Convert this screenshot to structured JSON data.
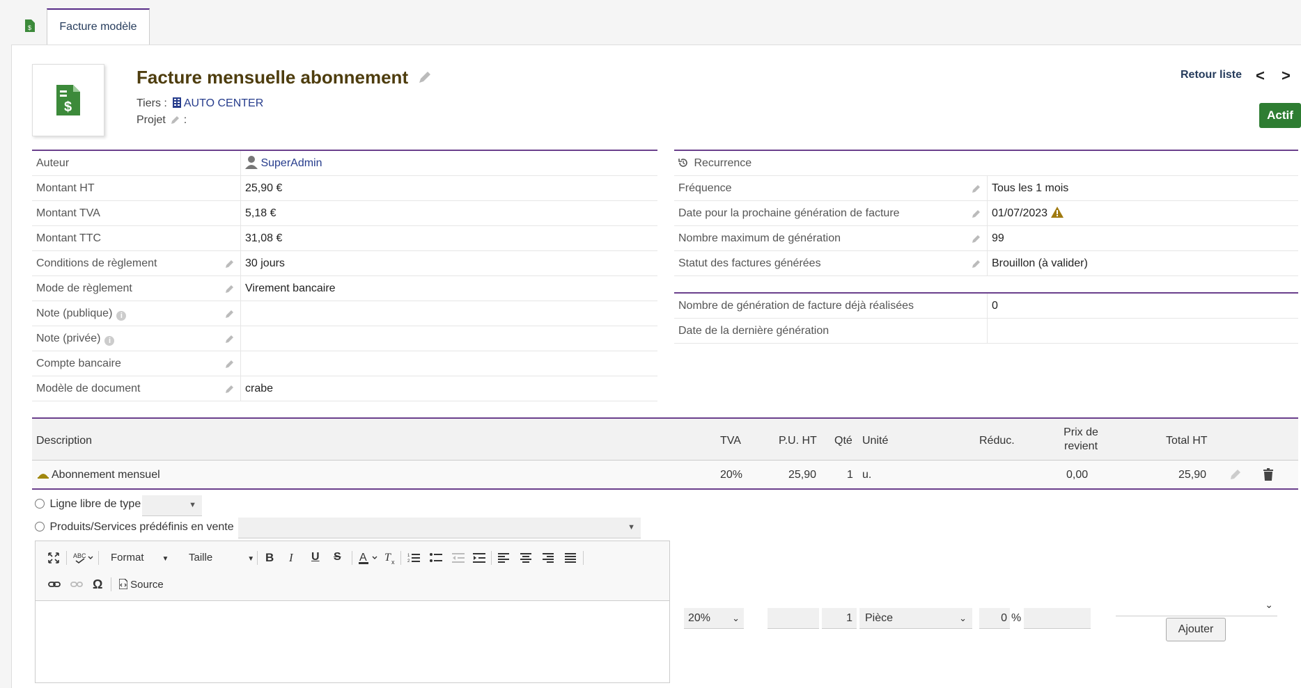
{
  "tabs": [
    {
      "label": "Facture modèle"
    }
  ],
  "header": {
    "ref": "Facture mensuelle abonnement",
    "tiers_label": "Tiers :",
    "tiers_name": "AUTO CENTER",
    "projet_label": "Projet",
    "projet_colon": ":",
    "back_label": "Retour liste",
    "prev_label": "<",
    "next_label": ">",
    "status": "Actif"
  },
  "left_fields": [
    {
      "label": "Auteur",
      "value": "SuperAdmin"
    },
    {
      "label": "Montant HT",
      "value": "25,90 €"
    },
    {
      "label": "Montant TVA",
      "value": "5,18 €"
    },
    {
      "label": "Montant TTC",
      "value": "31,08 €"
    },
    {
      "label": "Conditions de règlement",
      "value": "30 jours"
    },
    {
      "label": "Mode de règlement",
      "value": "Virement bancaire"
    },
    {
      "label": "Note (publique)",
      "value": ""
    },
    {
      "label": "Note (privée)",
      "value": ""
    },
    {
      "label": "Compte bancaire",
      "value": ""
    },
    {
      "label": "Modèle de document",
      "value": "crabe"
    }
  ],
  "recurrence": {
    "title": "Recurrence",
    "fields": [
      {
        "label": "Fréquence",
        "value": "Tous les 1 mois"
      },
      {
        "label": "Date pour la prochaine génération de facture",
        "value": "01/07/2023"
      },
      {
        "label": "Nombre maximum de génération",
        "value": "99"
      },
      {
        "label": "Statut des factures générées",
        "value": "Brouillon (à valider)"
      }
    ],
    "stats": [
      {
        "label": "Nombre de génération de facture déjà réalisées",
        "value": "0"
      },
      {
        "label": "Date de la dernière génération",
        "value": ""
      }
    ]
  },
  "lines_table": {
    "headers": {
      "description": "Description",
      "tva": "TVA",
      "pu_ht": "P.U. HT",
      "qty": "Qté",
      "unit": "Unité",
      "reduc": "Réduc.",
      "cost_line1": "Prix de",
      "cost_line2": "revient",
      "total_ht": "Total HT"
    },
    "rows": [
      {
        "description": "Abonnement mensuel",
        "tva": "20%",
        "pu_ht": "25,90",
        "qty": "1",
        "unit": "u.",
        "reduc": "",
        "cost": "0,00",
        "total_ht": "25,90"
      }
    ]
  },
  "add_line": {
    "option_free": "Ligne libre de type",
    "option_predefined": "Produits/Services prédéfinis en vente",
    "toolbar": {
      "format": "Format",
      "size": "Taille",
      "bold": "B",
      "italic": "I",
      "underline": "U",
      "strike": "S",
      "omega": "Ω",
      "source": "Source"
    },
    "vat": "20%",
    "qty": "1",
    "unit": "Pièce",
    "discount": "0",
    "percent": "%",
    "submit": "Ajouter"
  },
  "colors": {
    "accent": "#6a3f8c",
    "status": "#2e7d32",
    "title": "#4e3d0e",
    "link": "#263c8c"
  }
}
